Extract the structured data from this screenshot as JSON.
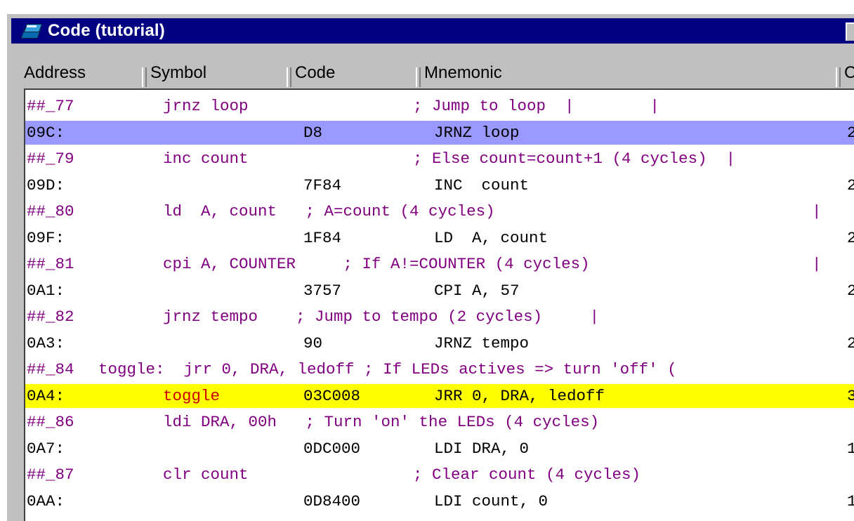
{
  "window": {
    "title": "Code (tutorial)",
    "icon": "books-icon"
  },
  "columns": [
    "Address",
    "Symbol",
    "Code",
    "Mnemonic",
    "C"
  ],
  "rows": [
    {
      "kind": "src",
      "a": "##_77",
      "b": "jrnz loop",
      "d": "; Jump to loop  |        |"
    },
    {
      "kind": "asm",
      "highlight": "blue",
      "a": "09C:",
      "code": "D8",
      "mn": "JRNZ loop",
      "c": "2"
    },
    {
      "kind": "src",
      "a": "##_79",
      "b": "inc count",
      "d": "; Else count=count+1 (4 cycles)  |"
    },
    {
      "kind": "asm",
      "a": "09D:",
      "code": "7F84",
      "mn": "INC  count",
      "c": "2"
    },
    {
      "kind": "src",
      "a": "##_80",
      "b": "ld  A, count   ; A=count (4 cycles)",
      "e": "|"
    },
    {
      "kind": "asm",
      "a": "09F:",
      "code": "1F84",
      "mn": "LD  A, count",
      "c": "2"
    },
    {
      "kind": "src",
      "a": "##_81",
      "b": "cpi A, COUNTER     ; If A!=COUNTER (4 cycles)",
      "e": "|"
    },
    {
      "kind": "asm",
      "a": "0A1:",
      "code": "3757",
      "mn": "CPI A, 57",
      "c": "2"
    },
    {
      "kind": "src",
      "a": "##_82",
      "b": "jrnz tempo    ; Jump to tempo (2 cycles)     |"
    },
    {
      "kind": "asm",
      "a": "0A3:",
      "code": "90",
      "mn": "JRNZ tempo",
      "c": "2"
    },
    {
      "kind": "src",
      "a": "##_84",
      "b": "toggle:  jrr 0, DRA, ledoff ; If LEDs actives => turn 'off' (",
      "wide": true
    },
    {
      "kind": "asm",
      "highlight": "yellow",
      "a": "0A4:",
      "sym": "toggle",
      "code": "03C008",
      "mn": "JRR 0, DRA, ledoff",
      "c": "3"
    },
    {
      "kind": "src",
      "a": "##_86",
      "b": "ldi DRA, 00h   ; Turn 'on' the LEDs (4 cycles)"
    },
    {
      "kind": "asm",
      "a": "0A7:",
      "code": "0DC000",
      "mn": "LDI DRA, 0",
      "c": "1"
    },
    {
      "kind": "src",
      "a": "##_87",
      "b": "clr count",
      "d": "; Clear count (4 cycles)"
    },
    {
      "kind": "asm",
      "a": "0AA:",
      "code": "0D8400",
      "mn": "LDI count, 0",
      "c": "1"
    }
  ]
}
